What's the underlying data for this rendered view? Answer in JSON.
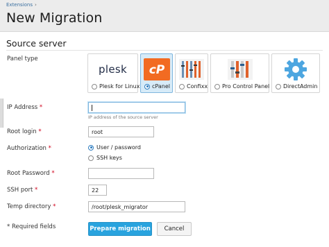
{
  "breadcrumb": {
    "item": "Extensions",
    "separator": "›"
  },
  "page": {
    "title": "New Migration"
  },
  "section": {
    "title": "Source server"
  },
  "panel_type": {
    "label": "Panel type",
    "options": [
      {
        "label": "Plesk for Linux",
        "selected": false,
        "icon": "plesk-logo",
        "logo_text": "plesk"
      },
      {
        "label": "cPanel",
        "selected": true,
        "icon": "cpanel-logo",
        "logo_text": "cP"
      },
      {
        "label": "Confixx",
        "selected": false,
        "icon": "confixx-logo"
      },
      {
        "label": "Pro Control Panel",
        "selected": false,
        "icon": "pro-control-panel-logo"
      },
      {
        "label": "DirectAdmin",
        "selected": false,
        "icon": "directadmin-gear-logo"
      }
    ]
  },
  "ip_address": {
    "label": "IP Address",
    "required_mark": "*",
    "value": "",
    "hint": "IP address of the source server"
  },
  "root_login": {
    "label": "Root login",
    "required_mark": "*",
    "value": "root"
  },
  "authorization": {
    "label": "Authorization",
    "required_mark": "*",
    "options": [
      {
        "label": "User / password",
        "selected": true
      },
      {
        "label": "SSH keys",
        "selected": false
      }
    ]
  },
  "root_password": {
    "label": "Root Password",
    "required_mark": "*",
    "value": ""
  },
  "ssh_port": {
    "label": "SSH port",
    "required_mark": "*",
    "value": "22"
  },
  "temp_directory": {
    "label": "Temp directory",
    "required_mark": "*",
    "value": "/root/plesk_migrator"
  },
  "footer": {
    "required_note": "* Required fields",
    "submit_label": "Prepare migration",
    "cancel_label": "Cancel"
  },
  "colors": {
    "primary_button": "#29a3de",
    "selected_card": "#d7ebf8",
    "cpanel_orange": "#f26b22",
    "required": "#d0021b",
    "link": "#3a6fa0"
  }
}
